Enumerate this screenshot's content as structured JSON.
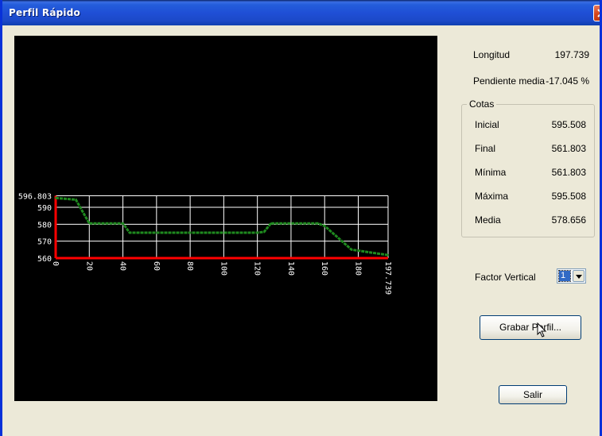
{
  "window": {
    "title": "Perfil Rápido"
  },
  "stats": {
    "longitud_label": "Longitud",
    "longitud_value": "197.739",
    "pendiente_label": "Pendiente media",
    "pendiente_value": "-17.045 %"
  },
  "cotas": {
    "legend": "Cotas",
    "rows": [
      {
        "label": "Inicial",
        "value": "595.508"
      },
      {
        "label": "Final",
        "value": "561.803"
      },
      {
        "label": "Mínima",
        "value": "561.803"
      },
      {
        "label": "Máxima",
        "value": "595.508"
      },
      {
        "label": "Media",
        "value": "578.656"
      }
    ]
  },
  "factor": {
    "label": "Factor Vertical",
    "value": "1"
  },
  "buttons": {
    "grabar": "Grabar Perfil...",
    "salir": "Salir"
  },
  "colors": {
    "profile_line": "#1f8a1f",
    "axis": "#ff0000",
    "grid": "#ffffff",
    "plot_bg": "#000000"
  },
  "chart_data": {
    "type": "line",
    "x_ticks": [
      "0",
      "20",
      "40",
      "60",
      "80",
      "100",
      "120",
      "140",
      "160",
      "180",
      "197.739"
    ],
    "y_ticks": [
      "596.803",
      "590",
      "580",
      "570",
      "560"
    ],
    "xlim": [
      0,
      197.739
    ],
    "ylim": [
      560,
      596.803
    ],
    "series": [
      {
        "x": [
          0,
          6,
          12,
          20,
          40,
          44,
          120,
          124,
          128,
          156,
          160,
          176,
          197.739
        ],
        "y": [
          595.5,
          595,
          594.5,
          580.5,
          580.5,
          575,
          575,
          575.5,
          580.5,
          580.5,
          579,
          565,
          561.8
        ]
      }
    ]
  }
}
